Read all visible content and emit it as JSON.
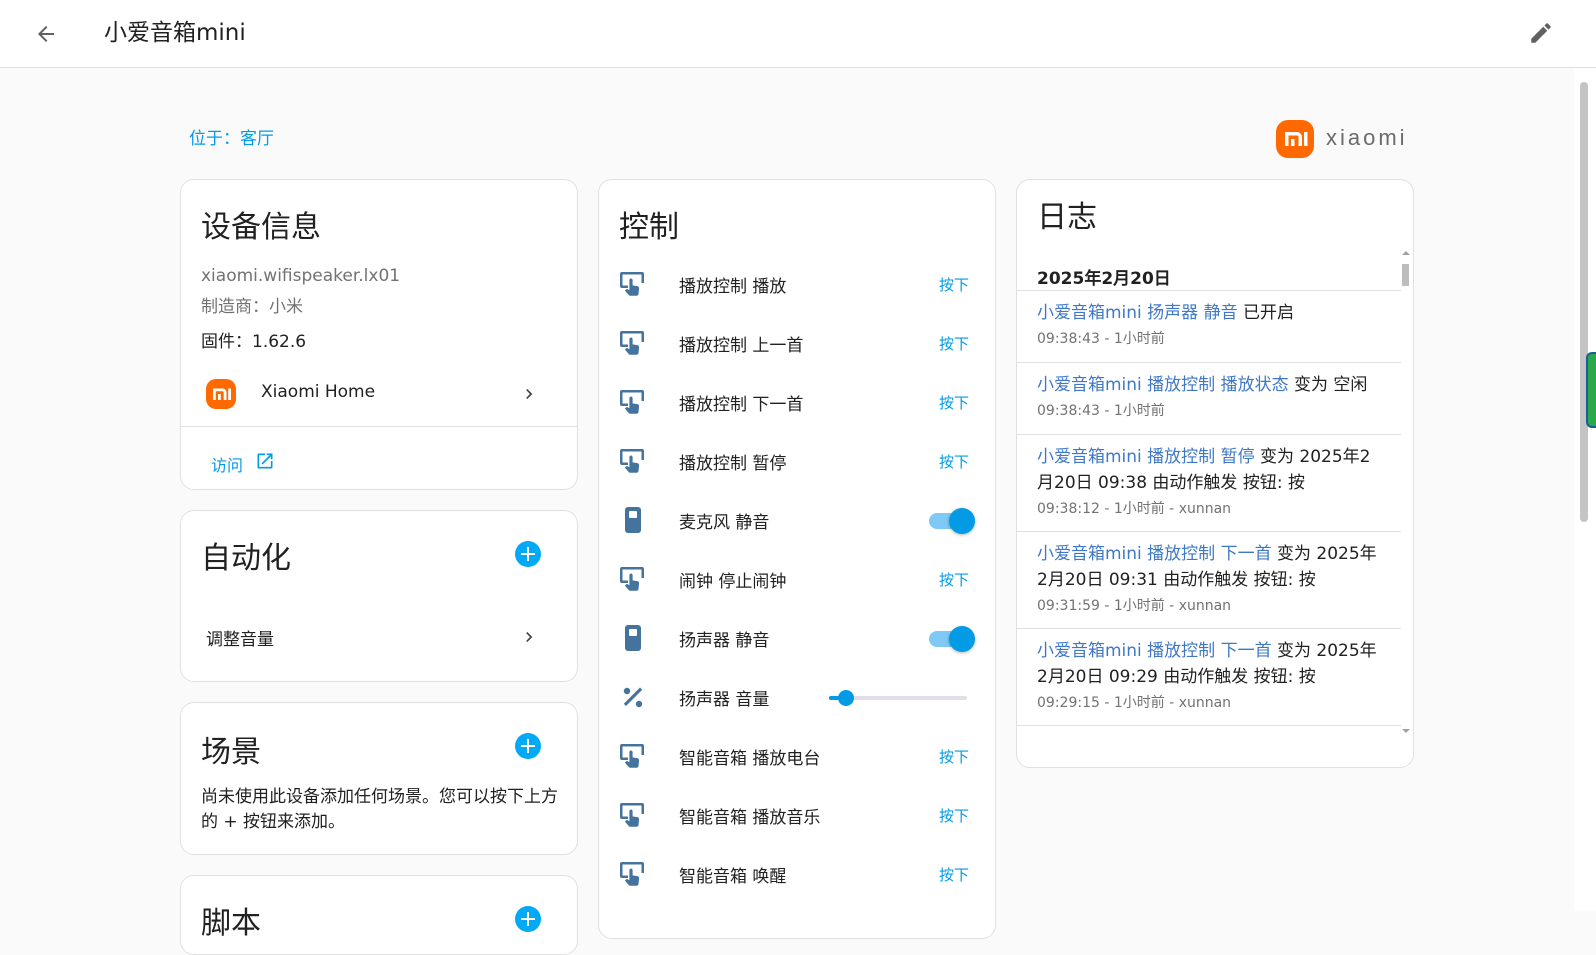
{
  "header": {
    "title": "小爱音箱mini"
  },
  "area": {
    "label": "位于：客厅"
  },
  "brand": {
    "name": "xiaomi",
    "mark": "mi",
    "color": "#ff6900"
  },
  "device_info": {
    "title": "设备信息",
    "model": "xiaomi.wifispeaker.lx01",
    "manufacturer": "制造商：小米",
    "firmware": "固件：1.62.6",
    "integration": "Xiaomi Home",
    "visit": "访问"
  },
  "automation": {
    "title": "自动化",
    "items": [
      "调整音量"
    ]
  },
  "scenes": {
    "title": "场景",
    "empty_text": "尚未使用此设备添加任何场景。您可以按下上方的 + 按钮来添加。"
  },
  "scripts": {
    "title": "脚本"
  },
  "controls": {
    "title": "控制",
    "press_label": "按下",
    "rows": [
      {
        "label": "播放控制 播放",
        "icon": "gesture-tap-button-icon",
        "kind": "button"
      },
      {
        "label": "播放控制 上一首",
        "icon": "gesture-tap-button-icon",
        "kind": "button"
      },
      {
        "label": "播放控制 下一首",
        "icon": "gesture-tap-button-icon",
        "kind": "button"
      },
      {
        "label": "播放控制 暂停",
        "icon": "gesture-tap-button-icon",
        "kind": "button"
      },
      {
        "label": "麦克风 静音",
        "icon": "switch-icon",
        "kind": "switch",
        "state": "on"
      },
      {
        "label": "闹钟 停止闹钟",
        "icon": "gesture-tap-button-icon",
        "kind": "button"
      },
      {
        "label": "扬声器 静音",
        "icon": "switch-icon",
        "kind": "switch",
        "state": "on"
      },
      {
        "label": "扬声器 音量",
        "icon": "percent-icon",
        "kind": "slider",
        "value_fraction": 0.12
      },
      {
        "label": "智能音箱 播放电台",
        "icon": "gesture-tap-button-icon",
        "kind": "button"
      },
      {
        "label": "智能音箱 播放音乐",
        "icon": "gesture-tap-button-icon",
        "kind": "button"
      },
      {
        "label": "智能音箱 唤醒",
        "icon": "gesture-tap-button-icon",
        "kind": "button"
      }
    ]
  },
  "logbook": {
    "title": "日志",
    "date": "2025年2月20日",
    "entries": [
      {
        "entity": "小爱音箱mini 扬声器 静音",
        "text": " 已开启",
        "meta": "09:38:43 - 1小时前"
      },
      {
        "entity": "小爱音箱mini 播放控制 播放状态",
        "text": " 变为 空闲",
        "meta": "09:38:43 - 1小时前"
      },
      {
        "entity": "小爱音箱mini 播放控制 暂停",
        "text": " 变为 2025年2月20日 09:38 由动作触发 按钮: 按",
        "meta": "09:38:12 - 1小时前 - xunnan"
      },
      {
        "entity": "小爱音箱mini 播放控制 下一首",
        "text": " 变为 2025年2月20日 09:31 由动作触发 按钮: 按",
        "meta": "09:31:59 - 1小时前 - xunnan"
      },
      {
        "entity": "小爱音箱mini 播放控制 下一首",
        "text": " 变为 2025年2月20日 09:29 由动作触发 按钮: 按",
        "meta": "09:29:15 - 1小时前 - xunnan"
      }
    ]
  },
  "colors": {
    "accent": "#03a9f4",
    "link": "#039be5",
    "entity_link": "#3f78c4",
    "icon": "#44739e"
  }
}
